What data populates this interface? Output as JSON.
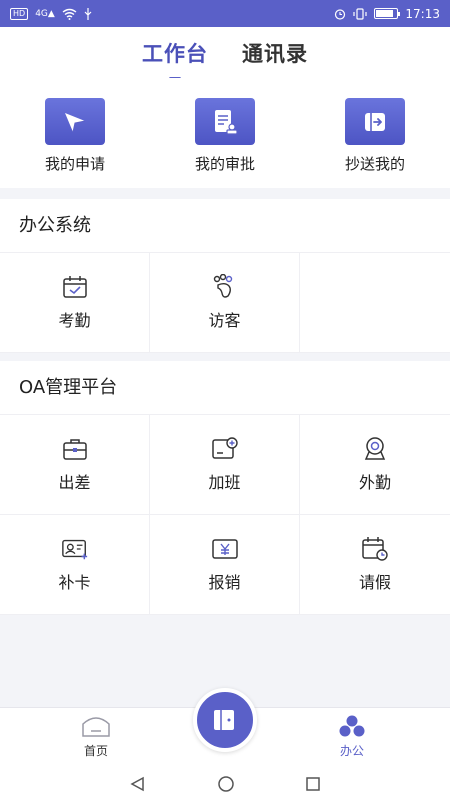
{
  "status_bar": {
    "network_tag": "HD",
    "signal_label": "4G",
    "time": "17:13"
  },
  "tabs": [
    {
      "label": "工作台",
      "active": true
    },
    {
      "label": "通讯录",
      "active": false
    }
  ],
  "quick_actions": [
    {
      "label": "我的申请",
      "icon": "paper-plane-icon"
    },
    {
      "label": "我的审批",
      "icon": "document-stamp-icon"
    },
    {
      "label": "抄送我的",
      "icon": "exit-arrow-icon"
    }
  ],
  "office_system": {
    "title": "办公系统",
    "items": [
      {
        "label": "考勤",
        "icon": "calendar-check-icon"
      },
      {
        "label": "访客",
        "icon": "footprints-icon"
      }
    ]
  },
  "oa_platform": {
    "title": "OA管理平台",
    "items": [
      {
        "label": "出差",
        "icon": "briefcase-icon"
      },
      {
        "label": "加班",
        "icon": "screen-clock-icon"
      },
      {
        "label": "外勤",
        "icon": "location-pin-icon"
      },
      {
        "label": "补卡",
        "icon": "id-card-add-icon"
      },
      {
        "label": "报销",
        "icon": "yen-receipt-icon"
      },
      {
        "label": "请假",
        "icon": "calendar-clock-icon"
      }
    ]
  },
  "bottom_nav": {
    "home_label": "首页",
    "office_label": "办公",
    "active": "office"
  },
  "colors": {
    "accent": "#5a60c8",
    "background": "#f3f4f8"
  }
}
